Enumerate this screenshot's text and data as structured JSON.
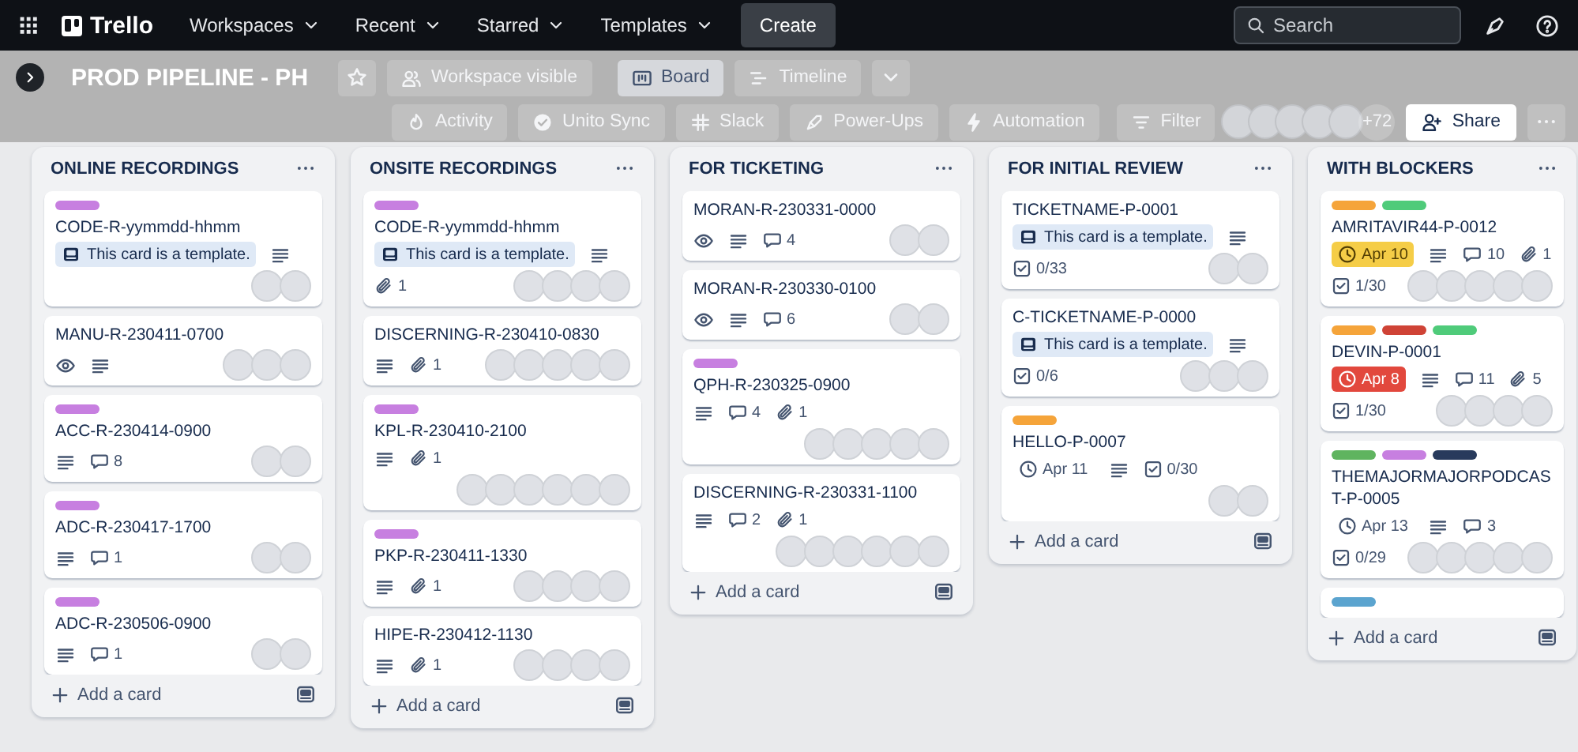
{
  "top_bar": {
    "logo": "Trello",
    "menus": [
      {
        "label": "Workspaces"
      },
      {
        "label": "Recent"
      },
      {
        "label": "Starred"
      },
      {
        "label": "Templates"
      }
    ],
    "create": "Create",
    "search": {
      "placeholder": "Search"
    }
  },
  "board_header": {
    "title": "PROD PIPELINE - PH",
    "visibility": "Workspace visible",
    "views": [
      {
        "label": "Board",
        "selected": true
      },
      {
        "label": "Timeline",
        "selected": false
      }
    ],
    "tools": [
      {
        "kind": "activity",
        "label": "Activity"
      },
      {
        "kind": "unito",
        "label": "Unito Sync"
      },
      {
        "kind": "slack",
        "label": "Slack"
      },
      {
        "kind": "power-ups",
        "label": "Power-Ups"
      },
      {
        "kind": "automation",
        "label": "Automation"
      }
    ],
    "filter": "Filter",
    "members": [
      {
        "kind": "avatar"
      },
      {
        "kind": "avatar"
      },
      {
        "kind": "avatar"
      },
      {
        "kind": "avatar"
      },
      {
        "kind": "avatar"
      }
    ],
    "more_members": "+72",
    "share": "Share"
  },
  "lists": [
    {
      "title": "ONLINE RECORDINGS",
      "add_card": "Add a card",
      "cards": [
        {
          "labels": [
            {
              "color": "#c77fe0"
            }
          ],
          "title": "CODE-R-yymmdd-hhmm",
          "badges": [
            {
              "kind": "template",
              "text": "This card is a template."
            },
            {
              "kind": "description"
            }
          ],
          "members": [
            {
              "kind": "avatar"
            },
            {
              "kind": "avatar"
            }
          ]
        },
        {
          "title": "MANU-R-230411-0700",
          "badges": [
            {
              "kind": "watch"
            },
            {
              "kind": "description"
            }
          ],
          "members": [
            {
              "kind": "avatar"
            },
            {
              "kind": "avatar"
            },
            {
              "kind": "avatar"
            }
          ]
        },
        {
          "labels": [
            {
              "color": "#c77fe0"
            }
          ],
          "title": "ACC-R-230414-0900",
          "badges": [
            {
              "kind": "description"
            },
            {
              "kind": "comments",
              "text": "8"
            }
          ],
          "members": [
            {
              "kind": "avatar"
            },
            {
              "kind": "avatar"
            }
          ]
        },
        {
          "labels": [
            {
              "color": "#c77fe0"
            }
          ],
          "title": "ADC-R-230417-1700",
          "badges": [
            {
              "kind": "description"
            },
            {
              "kind": "comments",
              "text": "1"
            }
          ],
          "members": [
            {
              "kind": "avatar"
            },
            {
              "kind": "avatar"
            }
          ]
        },
        {
          "labels": [
            {
              "color": "#c77fe0"
            }
          ],
          "title": "ADC-R-230506-0900",
          "badges": [
            {
              "kind": "description"
            },
            {
              "kind": "comments",
              "text": "1"
            }
          ],
          "members": [
            {
              "kind": "avatar"
            },
            {
              "kind": "avatar"
            }
          ]
        }
      ]
    },
    {
      "title": "ONSITE RECORDINGS",
      "add_card": "Add a card",
      "cards": [
        {
          "labels": [
            {
              "color": "#c77fe0"
            }
          ],
          "title": "CODE-R-yymmdd-hhmm",
          "badges": [
            {
              "kind": "template",
              "text": "This card is a template."
            },
            {
              "kind": "description"
            },
            {
              "kind": "attachments",
              "text": "1"
            }
          ],
          "members": [
            {
              "kind": "avatar"
            },
            {
              "kind": "avatar"
            },
            {
              "kind": "avatar"
            },
            {
              "kind": "avatar"
            }
          ]
        },
        {
          "title": "DISCERNING-R-230410-0830",
          "badges": [
            {
              "kind": "description"
            },
            {
              "kind": "attachments",
              "text": "1"
            }
          ],
          "members": [
            {
              "kind": "avatar"
            },
            {
              "kind": "avatar"
            },
            {
              "kind": "avatar"
            },
            {
              "kind": "avatar"
            },
            {
              "kind": "avatar"
            }
          ]
        },
        {
          "labels": [
            {
              "color": "#c77fe0"
            }
          ],
          "title": "KPL-R-230410-2100",
          "badges": [
            {
              "kind": "description"
            },
            {
              "kind": "attachments",
              "text": "1"
            }
          ],
          "members": [
            {
              "kind": "avatar"
            },
            {
              "kind": "avatar"
            },
            {
              "kind": "avatar"
            },
            {
              "kind": "avatar"
            },
            {
              "kind": "avatar"
            },
            {
              "kind": "avatar"
            }
          ]
        },
        {
          "labels": [
            {
              "color": "#c77fe0"
            }
          ],
          "title": "PKP-R-230411-1330",
          "badges": [
            {
              "kind": "description"
            },
            {
              "kind": "attachments",
              "text": "1"
            }
          ],
          "members": [
            {
              "kind": "avatar"
            },
            {
              "kind": "avatar"
            },
            {
              "kind": "avatar"
            },
            {
              "kind": "avatar"
            }
          ]
        },
        {
          "title": "HIPE-R-230412-1130",
          "badges": [
            {
              "kind": "description"
            },
            {
              "kind": "attachments",
              "text": "1"
            }
          ],
          "members": [
            {
              "kind": "avatar"
            },
            {
              "kind": "avatar"
            },
            {
              "kind": "avatar"
            },
            {
              "kind": "avatar"
            }
          ]
        }
      ]
    },
    {
      "title": "FOR TICKETING",
      "add_card": "Add a card",
      "cards": [
        {
          "title": "MORAN-R-230331-0000",
          "badges": [
            {
              "kind": "watch"
            },
            {
              "kind": "description"
            },
            {
              "kind": "comments",
              "text": "4"
            }
          ],
          "members": [
            {
              "kind": "avatar"
            },
            {
              "kind": "avatar"
            }
          ]
        },
        {
          "title": "MORAN-R-230330-0100",
          "badges": [
            {
              "kind": "watch"
            },
            {
              "kind": "description"
            },
            {
              "kind": "comments",
              "text": "6"
            }
          ],
          "members": [
            {
              "kind": "avatar"
            },
            {
              "kind": "avatar"
            }
          ]
        },
        {
          "labels": [
            {
              "color": "#c77fe0"
            }
          ],
          "title": "QPH-R-230325-0900",
          "badges": [
            {
              "kind": "description"
            },
            {
              "kind": "comments",
              "text": "4"
            },
            {
              "kind": "attachments",
              "text": "1"
            }
          ],
          "members": [
            {
              "kind": "avatar"
            },
            {
              "kind": "avatar"
            },
            {
              "kind": "avatar"
            },
            {
              "kind": "avatar"
            },
            {
              "kind": "avatar"
            }
          ]
        },
        {
          "title": "DISCERNING-R-230331-1100",
          "badges": [
            {
              "kind": "description"
            },
            {
              "kind": "comments",
              "text": "2"
            },
            {
              "kind": "attachments",
              "text": "1"
            }
          ],
          "members": [
            {
              "kind": "avatar"
            },
            {
              "kind": "avatar"
            },
            {
              "kind": "avatar"
            },
            {
              "kind": "avatar"
            },
            {
              "kind": "avatar"
            },
            {
              "kind": "avatar"
            }
          ]
        }
      ]
    },
    {
      "title": "FOR INITIAL REVIEW",
      "add_card": "Add a card",
      "cards": [
        {
          "title": "TICKETNAME-P-0001",
          "badges": [
            {
              "kind": "template",
              "text": "This card is a template."
            },
            {
              "kind": "description"
            },
            {
              "kind": "checklist",
              "text": "0/33",
              "complete": false
            }
          ],
          "members": [
            {
              "kind": "avatar"
            },
            {
              "kind": "avatar"
            }
          ]
        },
        {
          "title": "C-TICKETNAME-P-0000",
          "badges": [
            {
              "kind": "template",
              "text": "This card is a template."
            },
            {
              "kind": "description"
            },
            {
              "kind": "checklist",
              "text": "0/6",
              "complete": false
            }
          ],
          "members": [
            {
              "kind": "avatar"
            },
            {
              "kind": "avatar"
            },
            {
              "kind": "avatar"
            }
          ]
        },
        {
          "labels": [
            {
              "color": "#f5a43a"
            }
          ],
          "title": "HELLO-P-0007",
          "badges": [
            {
              "kind": "due",
              "text": "Apr 11",
              "due_soon": false,
              "overdue": false
            },
            {
              "kind": "description"
            },
            {
              "kind": "checklist",
              "text": "0/30",
              "complete": false
            }
          ],
          "members": [
            {
              "kind": "avatar"
            },
            {
              "kind": "avatar"
            }
          ]
        }
      ]
    },
    {
      "title": "WITH BLOCKERS",
      "add_card": "Add a card",
      "cards": [
        {
          "labels": [
            {
              "color": "#f5a43a"
            },
            {
              "color": "#4fcb7a"
            }
          ],
          "title": "AMRITAVIR44-P-0012",
          "badges": [
            {
              "kind": "due",
              "text": "Apr 10",
              "due_soon": true,
              "overdue": false
            },
            {
              "kind": "description"
            },
            {
              "kind": "comments",
              "text": "10"
            },
            {
              "kind": "attachments",
              "text": "1"
            },
            {
              "kind": "checklist",
              "text": "1/30",
              "complete": false
            }
          ],
          "members": [
            {
              "kind": "avatar"
            },
            {
              "kind": "avatar"
            },
            {
              "kind": "avatar"
            },
            {
              "kind": "avatar"
            },
            {
              "kind": "avatar"
            }
          ]
        },
        {
          "labels": [
            {
              "color": "#f5a43a"
            },
            {
              "color": "#cf4336"
            },
            {
              "color": "#4fcb7a"
            }
          ],
          "title": "DEVIN-P-0001",
          "badges": [
            {
              "kind": "due",
              "text": "Apr 8",
              "due_soon": false,
              "overdue": true
            },
            {
              "kind": "description"
            },
            {
              "kind": "comments",
              "text": "11"
            },
            {
              "kind": "attachments",
              "text": "5"
            },
            {
              "kind": "checklist",
              "text": "1/30",
              "complete": false
            }
          ],
          "members": [
            {
              "kind": "avatar"
            },
            {
              "kind": "avatar"
            },
            {
              "kind": "avatar"
            },
            {
              "kind": "avatar"
            }
          ]
        },
        {
          "labels": [
            {
              "color": "#5fb45f"
            },
            {
              "color": "#c77fe0"
            },
            {
              "color": "#283a5c"
            }
          ],
          "title": "THEMAJORMAJORPODCAST-P-0005",
          "badges": [
            {
              "kind": "due",
              "text": "Apr 13",
              "due_soon": false,
              "overdue": false
            },
            {
              "kind": "description"
            },
            {
              "kind": "comments",
              "text": "3"
            },
            {
              "kind": "checklist",
              "text": "0/29",
              "complete": false
            }
          ],
          "members": [
            {
              "kind": "avatar"
            },
            {
              "kind": "avatar"
            },
            {
              "kind": "avatar"
            },
            {
              "kind": "avatar"
            },
            {
              "kind": "avatar"
            }
          ]
        },
        {
          "labels": [
            {
              "color": "#5ba4cf"
            }
          ]
        }
      ]
    }
  ]
}
